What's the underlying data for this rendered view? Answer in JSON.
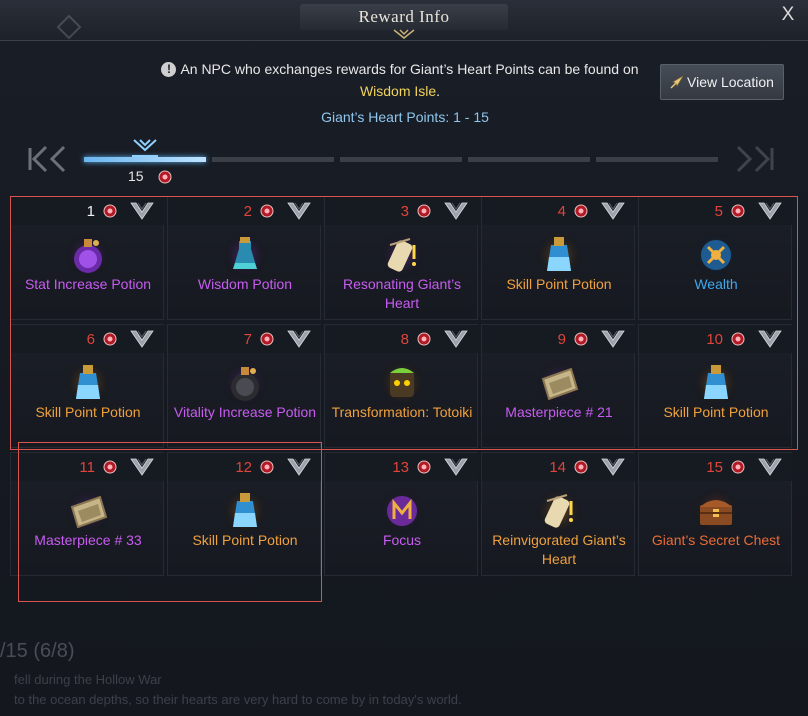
{
  "window": {
    "title": "Reward Info",
    "close_glyph": "X"
  },
  "info": {
    "text_before": "An NPC who exchanges rewards for Giant’s Heart Points can be found on",
    "location": "Wisdom Isle",
    "text_after": ".",
    "view_location_label": "View Location",
    "points_range": "Giant’s Heart Points: 1 - 15"
  },
  "progress": {
    "current_tier_points": "15",
    "segments": 5,
    "active_segments": 1
  },
  "rewards": [
    {
      "num": "1",
      "name": "Stat Increase Potion",
      "rarity": "purple",
      "icon": "stat-increase-potion-icon",
      "num_color": "white"
    },
    {
      "num": "2",
      "name": "Wisdom Potion",
      "rarity": "purple",
      "icon": "wisdom-potion-icon",
      "num_color": "red"
    },
    {
      "num": "3",
      "name": "Resonating Giant’s Heart",
      "rarity": "purple",
      "icon": "resonating-giants-heart-icon",
      "num_color": "red"
    },
    {
      "num": "4",
      "name": "Skill Point Potion",
      "rarity": "orange",
      "icon": "skill-point-potion-icon",
      "num_color": "red"
    },
    {
      "num": "5",
      "name": "Wealth",
      "rarity": "blue",
      "icon": "wealth-rune-icon",
      "num_color": "red"
    },
    {
      "num": "6",
      "name": "Skill Point Potion",
      "rarity": "orange",
      "icon": "skill-point-potion-icon",
      "num_color": "red"
    },
    {
      "num": "7",
      "name": "Vitality Increase Potion",
      "rarity": "purple",
      "icon": "vitality-increase-potion-icon",
      "num_color": "red"
    },
    {
      "num": "8",
      "name": "Transformation: Totoiki",
      "rarity": "orange",
      "icon": "transformation-totoiki-icon",
      "num_color": "red"
    },
    {
      "num": "9",
      "name": "Masterpiece # 21",
      "rarity": "purple",
      "icon": "masterpiece-painting-icon",
      "num_color": "red"
    },
    {
      "num": "10",
      "name": "Skill Point Potion",
      "rarity": "orange",
      "icon": "skill-point-potion-icon",
      "num_color": "red"
    },
    {
      "num": "11",
      "name": "Masterpiece # 33",
      "rarity": "purple",
      "icon": "masterpiece-painting-icon",
      "num_color": "red"
    },
    {
      "num": "12",
      "name": "Skill Point Potion",
      "rarity": "orange",
      "icon": "skill-point-potion-icon",
      "num_color": "red"
    },
    {
      "num": "13",
      "name": "Focus",
      "rarity": "purple",
      "icon": "focus-rune-icon",
      "num_color": "red"
    },
    {
      "num": "14",
      "name": "Reinvigorated Giant’s Heart",
      "rarity": "orange",
      "icon": "reinvigorated-giants-heart-icon",
      "num_color": "red"
    },
    {
      "num": "15",
      "name": "Giant’s Secret Chest",
      "rarity": "red",
      "icon": "giants-secret-chest-icon",
      "num_color": "red"
    }
  ],
  "background_text": {
    "counter": "/15 (6/8)",
    "line1": "fell during the Hollow War",
    "line2": "to the ocean depths, so their hearts are very hard to come by in today's world."
  },
  "colors": {
    "purple": "#c85cf2",
    "orange": "#f1a03d",
    "blue": "#3fa8ec",
    "red": "#ec6b35",
    "accent_blue": "#8fc6ee",
    "location_yellow": "#f2d35c",
    "highlight_border": "#d9534f"
  }
}
